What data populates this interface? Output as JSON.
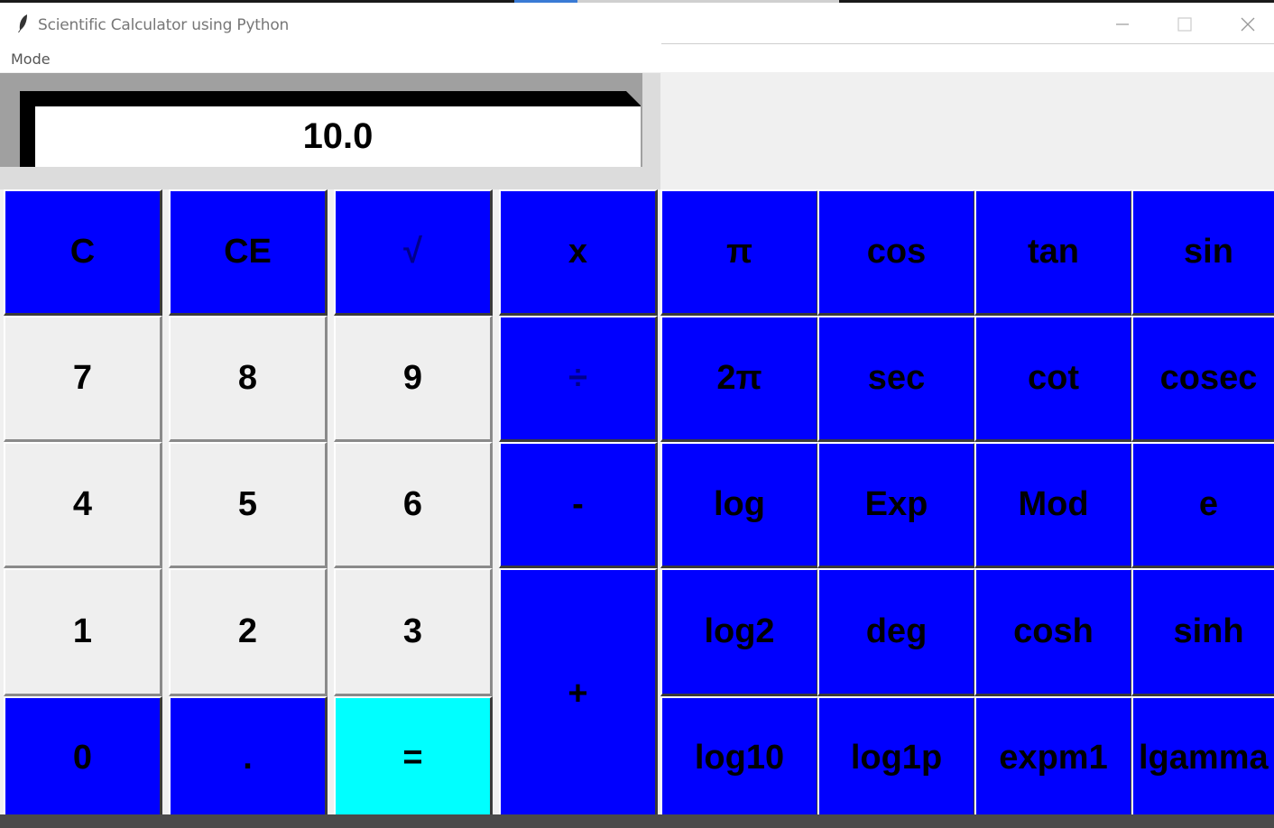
{
  "window": {
    "title": "Scientific Calculator using Python",
    "minimize": "—",
    "maximize": "☐",
    "close": "✕"
  },
  "menu": {
    "mode": "Mode"
  },
  "display": {
    "value": "10.0"
  },
  "colors": {
    "accent_blue": "#0000ff",
    "equals_cyan": "#00ffff",
    "digit_grey": "#efefef"
  },
  "buttons": {
    "clear": "C",
    "clear_entry": "CE",
    "sqrt": "√",
    "multiply": "x",
    "divide": "÷",
    "subtract": "-",
    "add": "+",
    "equals": "=",
    "dot": ".",
    "d0": "0",
    "d1": "1",
    "d2": "2",
    "d3": "3",
    "d4": "4",
    "d5": "5",
    "d6": "6",
    "d7": "7",
    "d8": "8",
    "d9": "9"
  },
  "scientific": [
    [
      "π",
      "cos",
      "tan",
      "sin"
    ],
    [
      "2π",
      "sec",
      "cot",
      "cosec"
    ],
    [
      "log",
      "Exp",
      "Mod",
      "e"
    ],
    [
      "log2",
      "deg",
      "cosh",
      "sinh"
    ],
    [
      "log10",
      "log1p",
      "expm1",
      "lgamma"
    ]
  ]
}
